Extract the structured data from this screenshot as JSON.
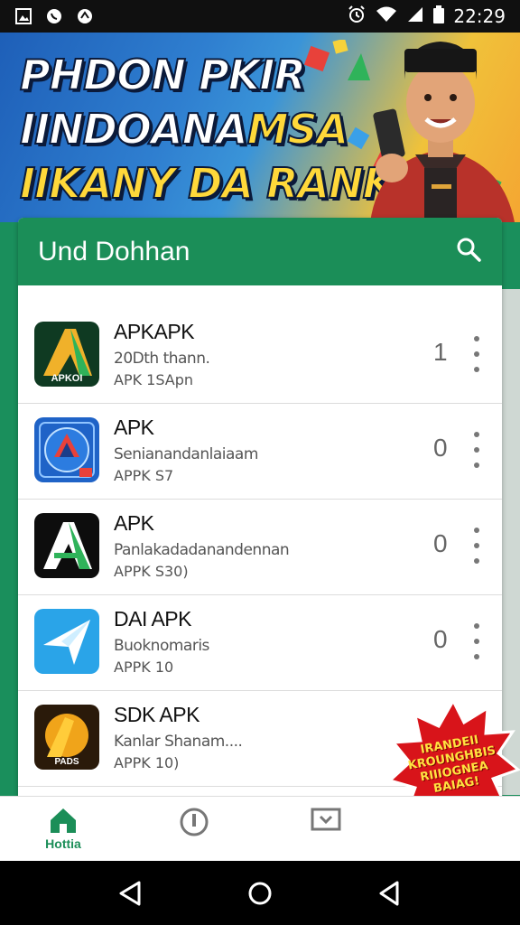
{
  "status_bar": {
    "time": "22:29",
    "left_icons": [
      "image-icon",
      "whatsapp-icon",
      "app-icon"
    ],
    "right_icons": [
      "alarm-icon",
      "wifi-icon",
      "signal-icon",
      "battery-icon"
    ]
  },
  "banner": {
    "line1": "PHDON PKIR",
    "line2a": "IINDOANA",
    "line2b": "MSA",
    "line3": "IIKANY DA RANKA"
  },
  "list_header": {
    "title": "Und Dohhan",
    "search_icon": "search-icon"
  },
  "apps": [
    {
      "name": "APKAPK",
      "subtitle": "20Dth thann.",
      "version": "APK 1SApn",
      "count": "1",
      "icon_label": "APKOI",
      "icon_bg": "#0f3a22"
    },
    {
      "name": "APK",
      "subtitle": "Senianandanlaiaam",
      "version": "APPK S7",
      "count": "0",
      "icon_label": "",
      "icon_bg": "#1f63c7"
    },
    {
      "name": "APK",
      "subtitle": "Panlakadadanandennan",
      "version": "APPK S30)",
      "count": "0",
      "icon_label": "",
      "icon_bg": "#0d0d0d"
    },
    {
      "name": "DAI APK",
      "subtitle": "Buoknomaris",
      "version": "APPK 10",
      "count": "0",
      "icon_label": "",
      "icon_bg": "#2aa4e8"
    },
    {
      "name": "SDK APK",
      "subtitle": "Kanlar Shanam....",
      "version": "APPK 10)",
      "count": "",
      "icon_label": "PADS",
      "icon_bg": "#2a1a0a"
    }
  ],
  "promo": {
    "lines": [
      "IRANDEII",
      "KROUNGHBIS",
      "RIIIOGNEA",
      "BAIAG!"
    ],
    "color": "#d8141a"
  },
  "bottom_nav": {
    "items": [
      {
        "label": "Hottia",
        "icon": "home-icon"
      },
      {
        "label": "",
        "icon": "info-icon"
      },
      {
        "label": "",
        "icon": "tv-icon"
      }
    ]
  },
  "system_nav": [
    "back-icon",
    "home-circle-icon",
    "recents-icon"
  ],
  "colors": {
    "accent": "#1b8e58",
    "status_bar": "#101010"
  }
}
